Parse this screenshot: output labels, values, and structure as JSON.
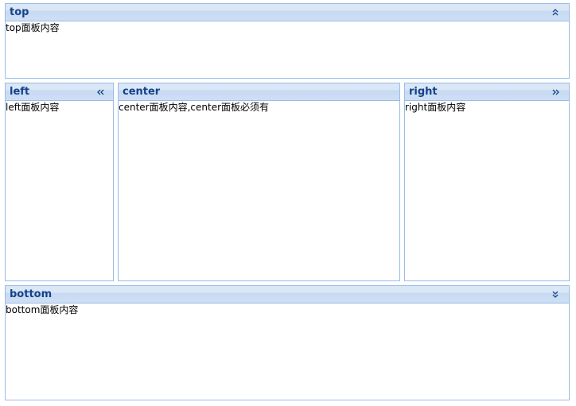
{
  "layout": {
    "top": {
      "title": "top",
      "content": "top面板内容",
      "tool_icon": "collapse-up-icon"
    },
    "left": {
      "title": "left",
      "content": "left面板内容",
      "tool_icon": "collapse-left-icon"
    },
    "center": {
      "title": "center",
      "content": "center面板内容,center面板必须有"
    },
    "right": {
      "title": "right",
      "content": "right面板内容",
      "tool_icon": "collapse-right-icon"
    },
    "bottom": {
      "title": "bottom",
      "content": "bottom面板内容",
      "tool_icon": "collapse-down-icon"
    }
  },
  "colors": {
    "border": "#99bbe8",
    "title": "#15428b",
    "header_bg": "#d3e2f5"
  }
}
